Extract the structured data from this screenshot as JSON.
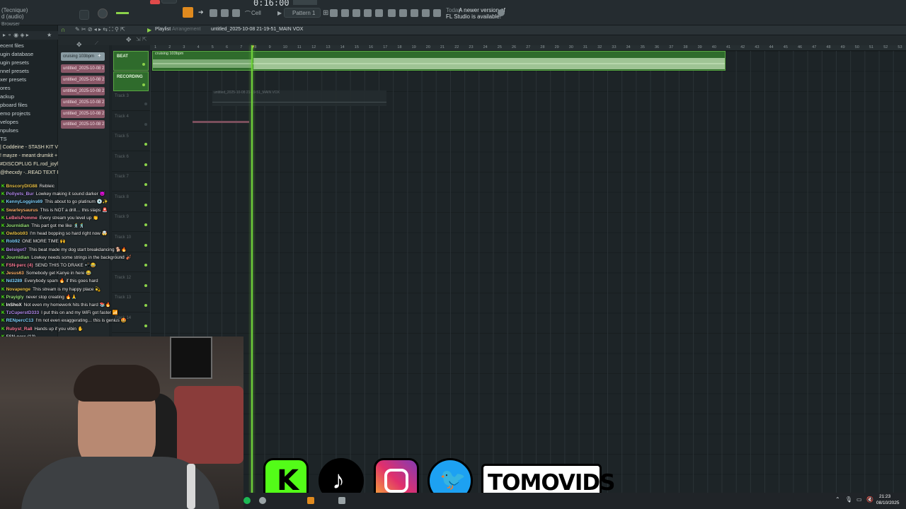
{
  "toolbar": {
    "time": "0:16:00",
    "pattern": "Pattern 1",
    "notification_today": "Today",
    "notification_text": "A newer version of",
    "notification_text2": "FL Studio is available!",
    "mode_label": "Cell",
    "preset_a": "(Tecnique)",
    "preset_b": "d (audio)"
  },
  "browser": {
    "title": "Browser",
    "items": [
      "ecent files",
      "ugin database",
      "ugin presets",
      "nnel presets",
      "xer presets",
      "ores",
      "ackup",
      "pboard files",
      "emo projects",
      "velopes",
      "npulses",
      "TS"
    ],
    "packs": [
      "| Coddeine - STASH KIT V3 |",
      "! mayze - meant drumkit +",
      "#DISCOPLUG FL.rod_joyful]",
      "@thecxdy -..READ TEXT FILE"
    ]
  },
  "playlist": {
    "title": "Playlist",
    "sub": "Arrangement",
    "project": "untitled_2025-10-08 21-19-51_MAIN VOX"
  },
  "cliplist": {
    "items": [
      "cruising 103bpm",
      "untitled_2025-10-08 21-...",
      "untitled_2025-10-08 21-...",
      "untitled_2025-10-08 21-...",
      "untitled_2025-10-08 21-...",
      "untitled_2025-10-08 21-...",
      "untitled_2025-10-08 21-..."
    ]
  },
  "tracks": [
    {
      "name": "BEAT",
      "active": true
    },
    {
      "name": "RECORDING",
      "active": true
    },
    {
      "name": "Track 3",
      "active": false
    },
    {
      "name": "Track 4",
      "active": false
    },
    {
      "name": "Track 5",
      "active": false
    },
    {
      "name": "Track 6",
      "active": false
    },
    {
      "name": "Track 7",
      "active": false
    },
    {
      "name": "Track 8",
      "active": false
    },
    {
      "name": "Track 9",
      "active": false
    },
    {
      "name": "Track 10",
      "active": false
    },
    {
      "name": "Track 11",
      "active": false
    },
    {
      "name": "Track 12",
      "active": false
    },
    {
      "name": "Track 13",
      "active": false
    },
    {
      "name": "Track 14",
      "active": false
    }
  ],
  "clips": {
    "beat_label": "cruising 103bpm",
    "vox_label": "untitled_2025-10-08 21-19-51_MAIN VOX"
  },
  "ruler_numbers": [
    "1",
    "2",
    "3",
    "4",
    "5",
    "6",
    "7",
    "8",
    "9",
    "10",
    "11",
    "12",
    "13",
    "14",
    "15",
    "16",
    "17",
    "18",
    "19",
    "20",
    "21",
    "22",
    "23",
    "24",
    "25",
    "26",
    "27",
    "28",
    "29",
    "30",
    "31",
    "32",
    "33",
    "34",
    "35",
    "36",
    "37",
    "38",
    "39",
    "40",
    "41",
    "42",
    "43",
    "44",
    "45",
    "46",
    "47",
    "48",
    "49",
    "50",
    "51",
    "52",
    "53"
  ],
  "chat": [
    {
      "user": "BnscoryDlG88",
      "color": "#e8c24a",
      "msg": "Rebleic"
    },
    {
      "user": "Pollyets_Bur",
      "color": "#b58cf0",
      "msg": "Lowkey making it sound darker 😈"
    },
    {
      "user": "KennyLoggins69",
      "color": "#7fd3ff",
      "msg": "This about to go platinum 💿✨"
    },
    {
      "user": "Swarleysaurus",
      "color": "#ffb36b",
      "msg": "This is NOT a drill… this slaps 🚨"
    },
    {
      "user": "LeBelsPomme",
      "color": "#ff7f9a",
      "msg": "Every stream you level up 👏"
    },
    {
      "user": "Journidian",
      "color": "#9ae57a",
      "msg": "This part got me like 🕺🕺"
    },
    {
      "user": "Owlbob93",
      "color": "#e8c24a",
      "msg": "I'm head bopping so hard right now 🤯"
    },
    {
      "user": "Rob92",
      "color": "#7fd3ff",
      "msg": "ONE MORE TIME 🙌"
    },
    {
      "user": "Belsigot7",
      "color": "#b58cf0",
      "msg": "This beat made my dog start breakdancing 🐕🔥"
    },
    {
      "user": "Journidian",
      "color": "#9ae57a",
      "msg": "Lowkey needs some strings in the background 🎻"
    },
    {
      "user": "FSN-perc (4)",
      "color": "#ff7f9a",
      "msg": "SEND THIS TO DRAKE 📲😂"
    },
    {
      "user": "Jesus63",
      "color": "#ffb36b",
      "msg": "Somebody get Kanye in here 😂"
    },
    {
      "user": "Nd3289",
      "color": "#7fd3ff",
      "msg": "Everybody spam 🔥 if this goes hard"
    },
    {
      "user": "Novapenge",
      "color": "#e8c24a",
      "msg": "This stream is my happy place 💫"
    },
    {
      "user": "Prayigly",
      "color": "#9ae57a",
      "msg": "never stop creating 🔥🙏"
    },
    {
      "user": "InShoX",
      "color": "#ffffff",
      "msg": "Not even my homework hits this hard 📚🔥"
    },
    {
      "user": "TzCuperstD333",
      "color": "#b58cf0",
      "msg": "I put this on and my WiFi got faster 📶"
    },
    {
      "user": "RENpercC13",
      "color": "#7fd3ff",
      "msg": "I'm not even exaggerating… this is genius 🤩"
    },
    {
      "user": "Rubyst_Ra8",
      "color": "#ff7f9a",
      "msg": "Hands up if you vibin ✋"
    },
    {
      "user": "FSN-perc (13)",
      "color": "#c4cdd0",
      "msg": ""
    }
  ],
  "social": {
    "brand": "TOMOVIDS",
    "kick_letter": "K"
  },
  "taskbar": {
    "time": "21:23",
    "date": "08/10/2025"
  }
}
